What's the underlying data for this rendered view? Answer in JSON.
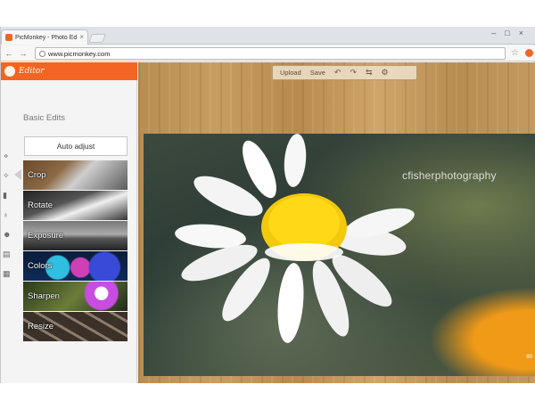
{
  "browser": {
    "tab_title": "PicMonkey - Photo Editing",
    "tab_close": "×",
    "url": "www.picmonkey.com",
    "window_controls": [
      "–",
      "□",
      "×"
    ],
    "nav": {
      "back": "←",
      "forward": "→",
      "reload": "C"
    }
  },
  "app": {
    "brand": "Editor",
    "section_title": "Basic Edits",
    "auto_adjust": "Auto adjust",
    "tools": [
      {
        "label": "Crop"
      },
      {
        "label": "Rotate"
      },
      {
        "label": "Exposure"
      },
      {
        "label": "Colors"
      },
      {
        "label": "Sharpen"
      },
      {
        "label": "Resize"
      }
    ],
    "editbar": {
      "upload": "Upload",
      "save": "Save",
      "undo_icon": "undo-icon",
      "redo_icon": "redo-icon",
      "compare_icon": "compare-icon",
      "settings_icon": "gear-icon"
    },
    "photo": {
      "watermark": "cfisherphotography",
      "corner_text": "80"
    }
  },
  "colors": {
    "accent": "#f26522",
    "canvas_wood": "#b88d52"
  }
}
